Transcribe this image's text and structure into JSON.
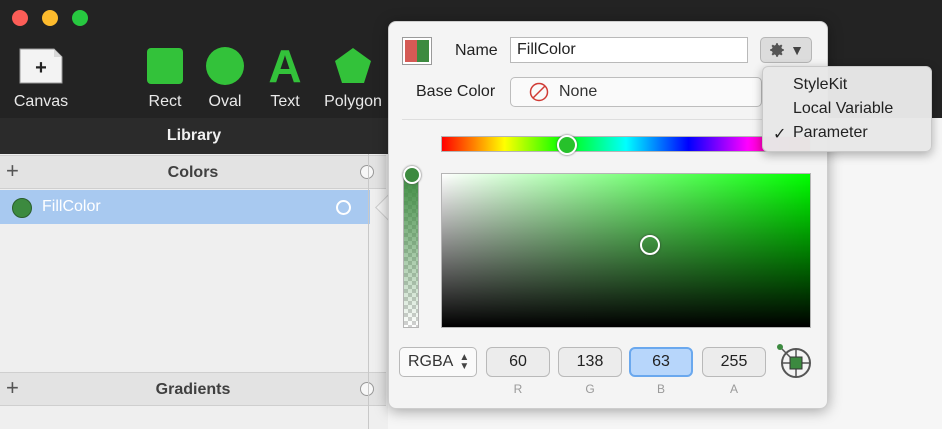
{
  "toolbar": {
    "tools": [
      {
        "label": "Canvas",
        "icon": "new-canvas-icon"
      },
      {
        "label": "Rect",
        "icon": "rect-icon"
      },
      {
        "label": "Oval",
        "icon": "oval-icon"
      },
      {
        "label": "Text",
        "icon": "text-icon"
      },
      {
        "label": "Polygon",
        "icon": "polygon-icon"
      }
    ],
    "text_glyph": "A",
    "accent": "#33c23a"
  },
  "sidebar": {
    "header": "Library",
    "colors_section": "Colors",
    "gradients_section": "Gradients",
    "items": [
      {
        "label": "FillColor",
        "color": "#3c8a3f"
      }
    ]
  },
  "popover": {
    "name_label": "Name",
    "name_value": "FillColor",
    "base_color_label": "Base Color",
    "base_color_value": "None",
    "mode": "RGBA",
    "channels": [
      {
        "label": "R",
        "value": "60"
      },
      {
        "label": "G",
        "value": "138"
      },
      {
        "label": "B",
        "value": "63"
      },
      {
        "label": "A",
        "value": "255"
      }
    ],
    "hue_fraction": 0.34,
    "alpha_fraction": 1.0,
    "saturation_fraction": 0.56,
    "brightness_fraction": 0.54
  },
  "menu": {
    "items": [
      {
        "label": "StyleKit",
        "checked": false
      },
      {
        "label": "Local Variable",
        "checked": false
      },
      {
        "label": "Parameter",
        "checked": true
      }
    ],
    "check_glyph": "✓"
  },
  "window_controls": {
    "close": "#fc5d57",
    "minimize": "#fdbb2d",
    "zoom": "#27c840"
  }
}
